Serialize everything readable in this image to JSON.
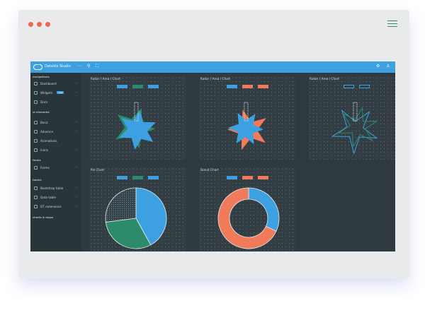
{
  "window": {
    "dots": [
      "#f0664a",
      "#f0664a",
      "#f0664a"
    ]
  },
  "topbar": {
    "brand": "DataVis Studio",
    "menu_glyph": "⋯",
    "search_glyph": "⚲",
    "expand_glyph": "⛶"
  },
  "sidebar": {
    "sections": [
      {
        "title": "navigations"
      },
      {
        "title": "ui elements"
      },
      {
        "title": "forms"
      },
      {
        "title": "tables"
      },
      {
        "title": "charts & maps"
      }
    ],
    "items": [
      {
        "label": "Dashboard"
      },
      {
        "label": "Widgets",
        "badge": "new"
      },
      {
        "label": "Docs"
      },
      {
        "label": "Basic"
      },
      {
        "label": "Advance"
      },
      {
        "label": "Animations"
      },
      {
        "label": "Icons"
      },
      {
        "label": "Forms"
      },
      {
        "label": "Bootstrap table"
      },
      {
        "label": "Data table"
      },
      {
        "label": "DT extensions"
      }
    ]
  },
  "panels": [
    {
      "title": "Radar ( Area ) Chart",
      "legend": [
        "#3da0e0",
        "#2e8b6a",
        "#3da0e0"
      ]
    },
    {
      "title": "Radar ( Area ) Chart",
      "legend": [
        "#3da0e0",
        "#f07a5a",
        "#f07a5a"
      ]
    },
    {
      "title": "Radar ( Area ) Chart",
      "legend": [
        "#3da0e0",
        "#3da0e0"
      ]
    },
    {
      "title": "Pie Chart",
      "legend": [
        "#3da0e0",
        "#2e8b6a",
        "#3da0e0"
      ]
    },
    {
      "title": "Donut Chart",
      "legend": [
        "#3da0e0",
        "#f07a5a",
        "#f07a5a"
      ]
    }
  ],
  "colors": {
    "blue": "#3da0e0",
    "green": "#2e8b6a",
    "orange": "#f07a5a"
  },
  "pie": {
    "values": [
      42,
      31,
      27
    ]
  },
  "donut": {
    "values": [
      32,
      68
    ]
  }
}
